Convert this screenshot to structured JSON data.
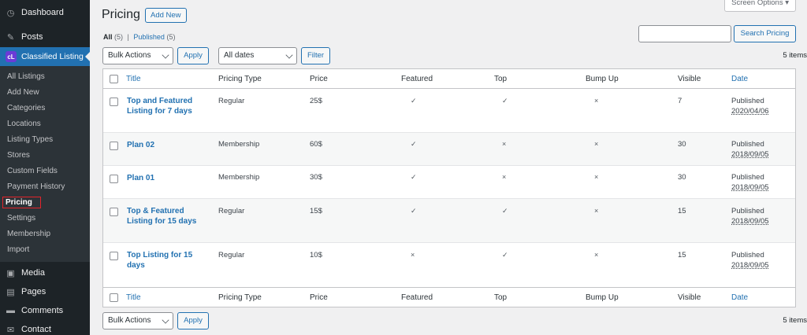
{
  "sidebar": {
    "top": [
      {
        "label": "Dashboard",
        "icon": "dashboard-icon"
      },
      {
        "label": "Posts",
        "icon": "pin-icon"
      }
    ],
    "current": {
      "label": "Classified Listing",
      "logo_text": "cL"
    },
    "submenu": [
      "All Listings",
      "Add New",
      "Categories",
      "Locations",
      "Listing Types",
      "Stores",
      "Custom Fields",
      "Payment History",
      "Pricing",
      "Settings",
      "Membership",
      "Import"
    ],
    "bottom": [
      {
        "label": "Media",
        "icon": "media-icon"
      },
      {
        "label": "Pages",
        "icon": "pages-icon"
      },
      {
        "label": "Comments",
        "icon": "comments-icon"
      },
      {
        "label": "Contact",
        "icon": "mail-icon"
      }
    ]
  },
  "header": {
    "title": "Pricing",
    "add_new": "Add New",
    "screen_options": "Screen Options ▾"
  },
  "views": {
    "all_label": "All",
    "all_count": "(5)",
    "sep": "|",
    "published_label": "Published",
    "published_count": "(5)"
  },
  "search": {
    "button": "Search Pricing",
    "value": ""
  },
  "tablenav_top": {
    "bulk": "Bulk Actions",
    "apply": "Apply",
    "dates": "All dates",
    "filter": "Filter",
    "items": "5 items"
  },
  "tablenav_bottom": {
    "bulk": "Bulk Actions",
    "apply": "Apply",
    "items": "5 items"
  },
  "columns": [
    "Title",
    "Pricing Type",
    "Price",
    "Featured",
    "Top",
    "Bump Up",
    "Visible",
    "Date"
  ],
  "rows": [
    {
      "title": "Top and Featured Listing for 7 days",
      "type": "Regular",
      "price": "25$",
      "featured": "✓",
      "top": "✓",
      "bump": "×",
      "visible": "7",
      "status": "Published",
      "date": "2020/04/06"
    },
    {
      "title": "Plan 02",
      "type": "Membership",
      "price": "60$",
      "featured": "✓",
      "top": "×",
      "bump": "×",
      "visible": "30",
      "status": "Published",
      "date": "2018/09/05"
    },
    {
      "title": "Plan 01",
      "type": "Membership",
      "price": "30$",
      "featured": "✓",
      "top": "×",
      "bump": "×",
      "visible": "30",
      "status": "Published",
      "date": "2018/09/05"
    },
    {
      "title": "Top & Featured Listing for 15 days",
      "type": "Regular",
      "price": "15$",
      "featured": "✓",
      "top": "✓",
      "bump": "×",
      "visible": "15",
      "status": "Published",
      "date": "2018/09/05"
    },
    {
      "title": "Top Listing for 15 days",
      "type": "Regular",
      "price": "10$",
      "featured": "×",
      "top": "✓",
      "bump": "×",
      "visible": "15",
      "status": "Published",
      "date": "2018/09/05"
    }
  ],
  "colors": {
    "sidebar_bg": "#1d2327",
    "accent": "#2271b1",
    "highlight_box": "#e3242b"
  }
}
